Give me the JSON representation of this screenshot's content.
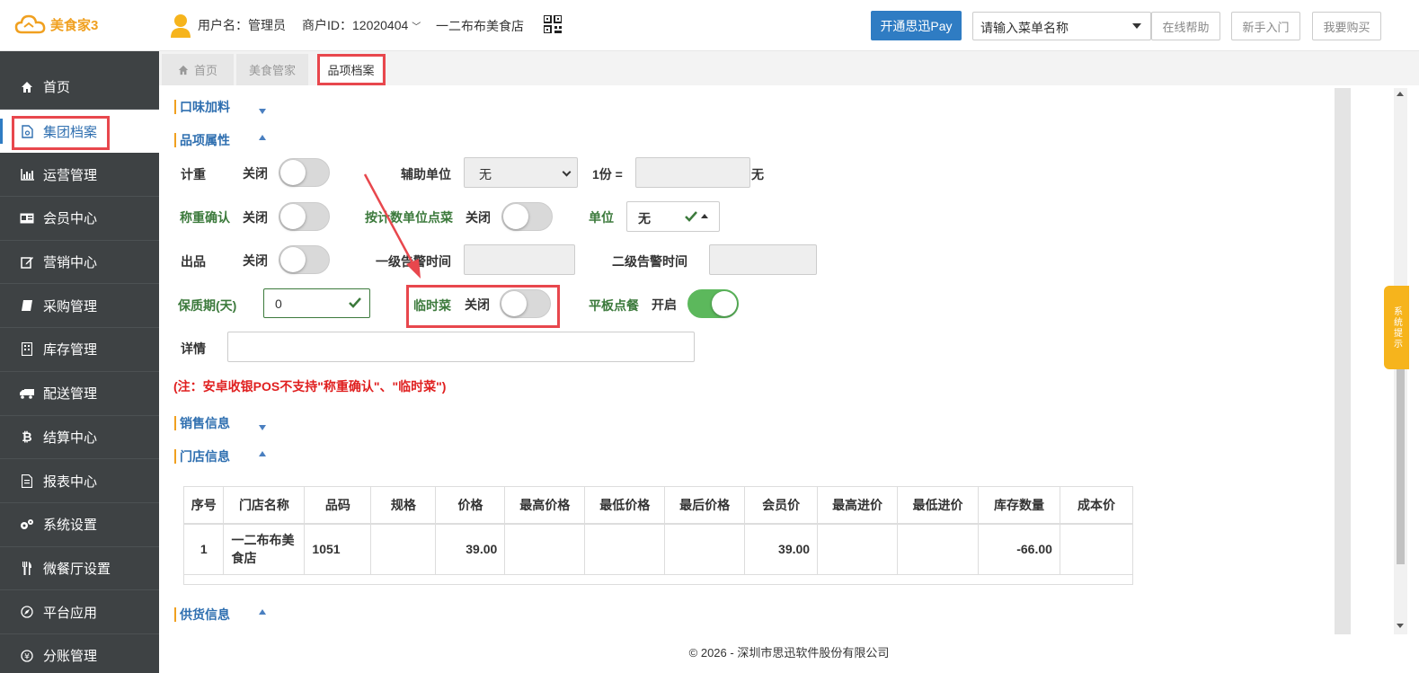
{
  "header": {
    "logo_text": "美食家3",
    "username": "用户名：管理员",
    "merchant_id": "商户ID：12020404",
    "shop_name": "一二布布美食店",
    "pay_button": "开通思迅Pay",
    "search_placeholder": "请输入菜单名称",
    "help_button": "在线帮助",
    "newbie_button": "新手入门",
    "buy_button": "我要购买"
  },
  "sidebar": {
    "items": [
      {
        "label": "首页",
        "icon": "home-icon"
      },
      {
        "label": "集团档案",
        "icon": "file-icon",
        "active": true
      },
      {
        "label": "运营管理",
        "icon": "bar-chart-icon"
      },
      {
        "label": "会员中心",
        "icon": "id-card-icon"
      },
      {
        "label": "营销中心",
        "icon": "edit-icon"
      },
      {
        "label": "采购管理",
        "icon": "book-icon"
      },
      {
        "label": "库存管理",
        "icon": "building-icon"
      },
      {
        "label": "配送管理",
        "icon": "truck-icon"
      },
      {
        "label": "结算中心",
        "icon": "bitcoin-icon"
      },
      {
        "label": "报表中心",
        "icon": "report-icon"
      },
      {
        "label": "系统设置",
        "icon": "gears-icon"
      },
      {
        "label": "微餐厅设置",
        "icon": "cutlery-icon"
      },
      {
        "label": "平台应用",
        "icon": "compass-icon"
      },
      {
        "label": "分账管理",
        "icon": "yen-icon"
      }
    ]
  },
  "tabs": [
    {
      "label": "首页"
    },
    {
      "label": "美食管家"
    },
    {
      "label": "品项档案"
    }
  ],
  "sections": {
    "flavor": "口味加料",
    "attributes": "品项属性",
    "sales": "销售信息",
    "store": "门店信息",
    "supply": "供货信息"
  },
  "form": {
    "weigh_label": "计重",
    "weigh_state": "关闭",
    "aux_unit_label": "辅助单位",
    "aux_unit_value": "无",
    "one_portion_label": "1份 =",
    "one_portion_suffix": "无",
    "weigh_confirm_label": "称重确认",
    "weigh_confirm_state": "关闭",
    "count_unit_label": "按计数单位点菜",
    "count_unit_state": "关闭",
    "unit_label": "单位",
    "unit_value": "无",
    "output_label": "出品",
    "output_state": "关闭",
    "alert1_label": "一级告警时间",
    "alert2_label": "二级告警时间",
    "shelf_life_label": "保质期(天)",
    "shelf_life_value": "0",
    "temp_dish_label": "临时菜",
    "temp_dish_state": "关闭",
    "tablet_label": "平板点餐",
    "tablet_state": "开启",
    "detail_label": "详情"
  },
  "note": "(注：安卓收银POS不支持\"称重确认\"、\"临时菜\")",
  "table": {
    "headers": [
      "序号",
      "门店名称",
      "品码",
      "规格",
      "价格",
      "最高价格",
      "最低价格",
      "最后价格",
      "会员价",
      "最高进价",
      "最低进价",
      "库存数量",
      "成本价"
    ],
    "rows": [
      [
        "1",
        "一二布布美食店",
        "1051",
        "",
        "39.00",
        "",
        "",
        "",
        "39.00",
        "",
        "",
        "-66.00",
        ""
      ]
    ]
  },
  "floating_tip": "系统提示",
  "footer": "© 2026 - 深圳市思迅软件股份有限公司",
  "colors": {
    "accent_blue": "#2f7cc3",
    "sidebar_bg": "#3e4244",
    "highlight_red": "#e8474d",
    "toggle_on": "#5cb85c"
  }
}
